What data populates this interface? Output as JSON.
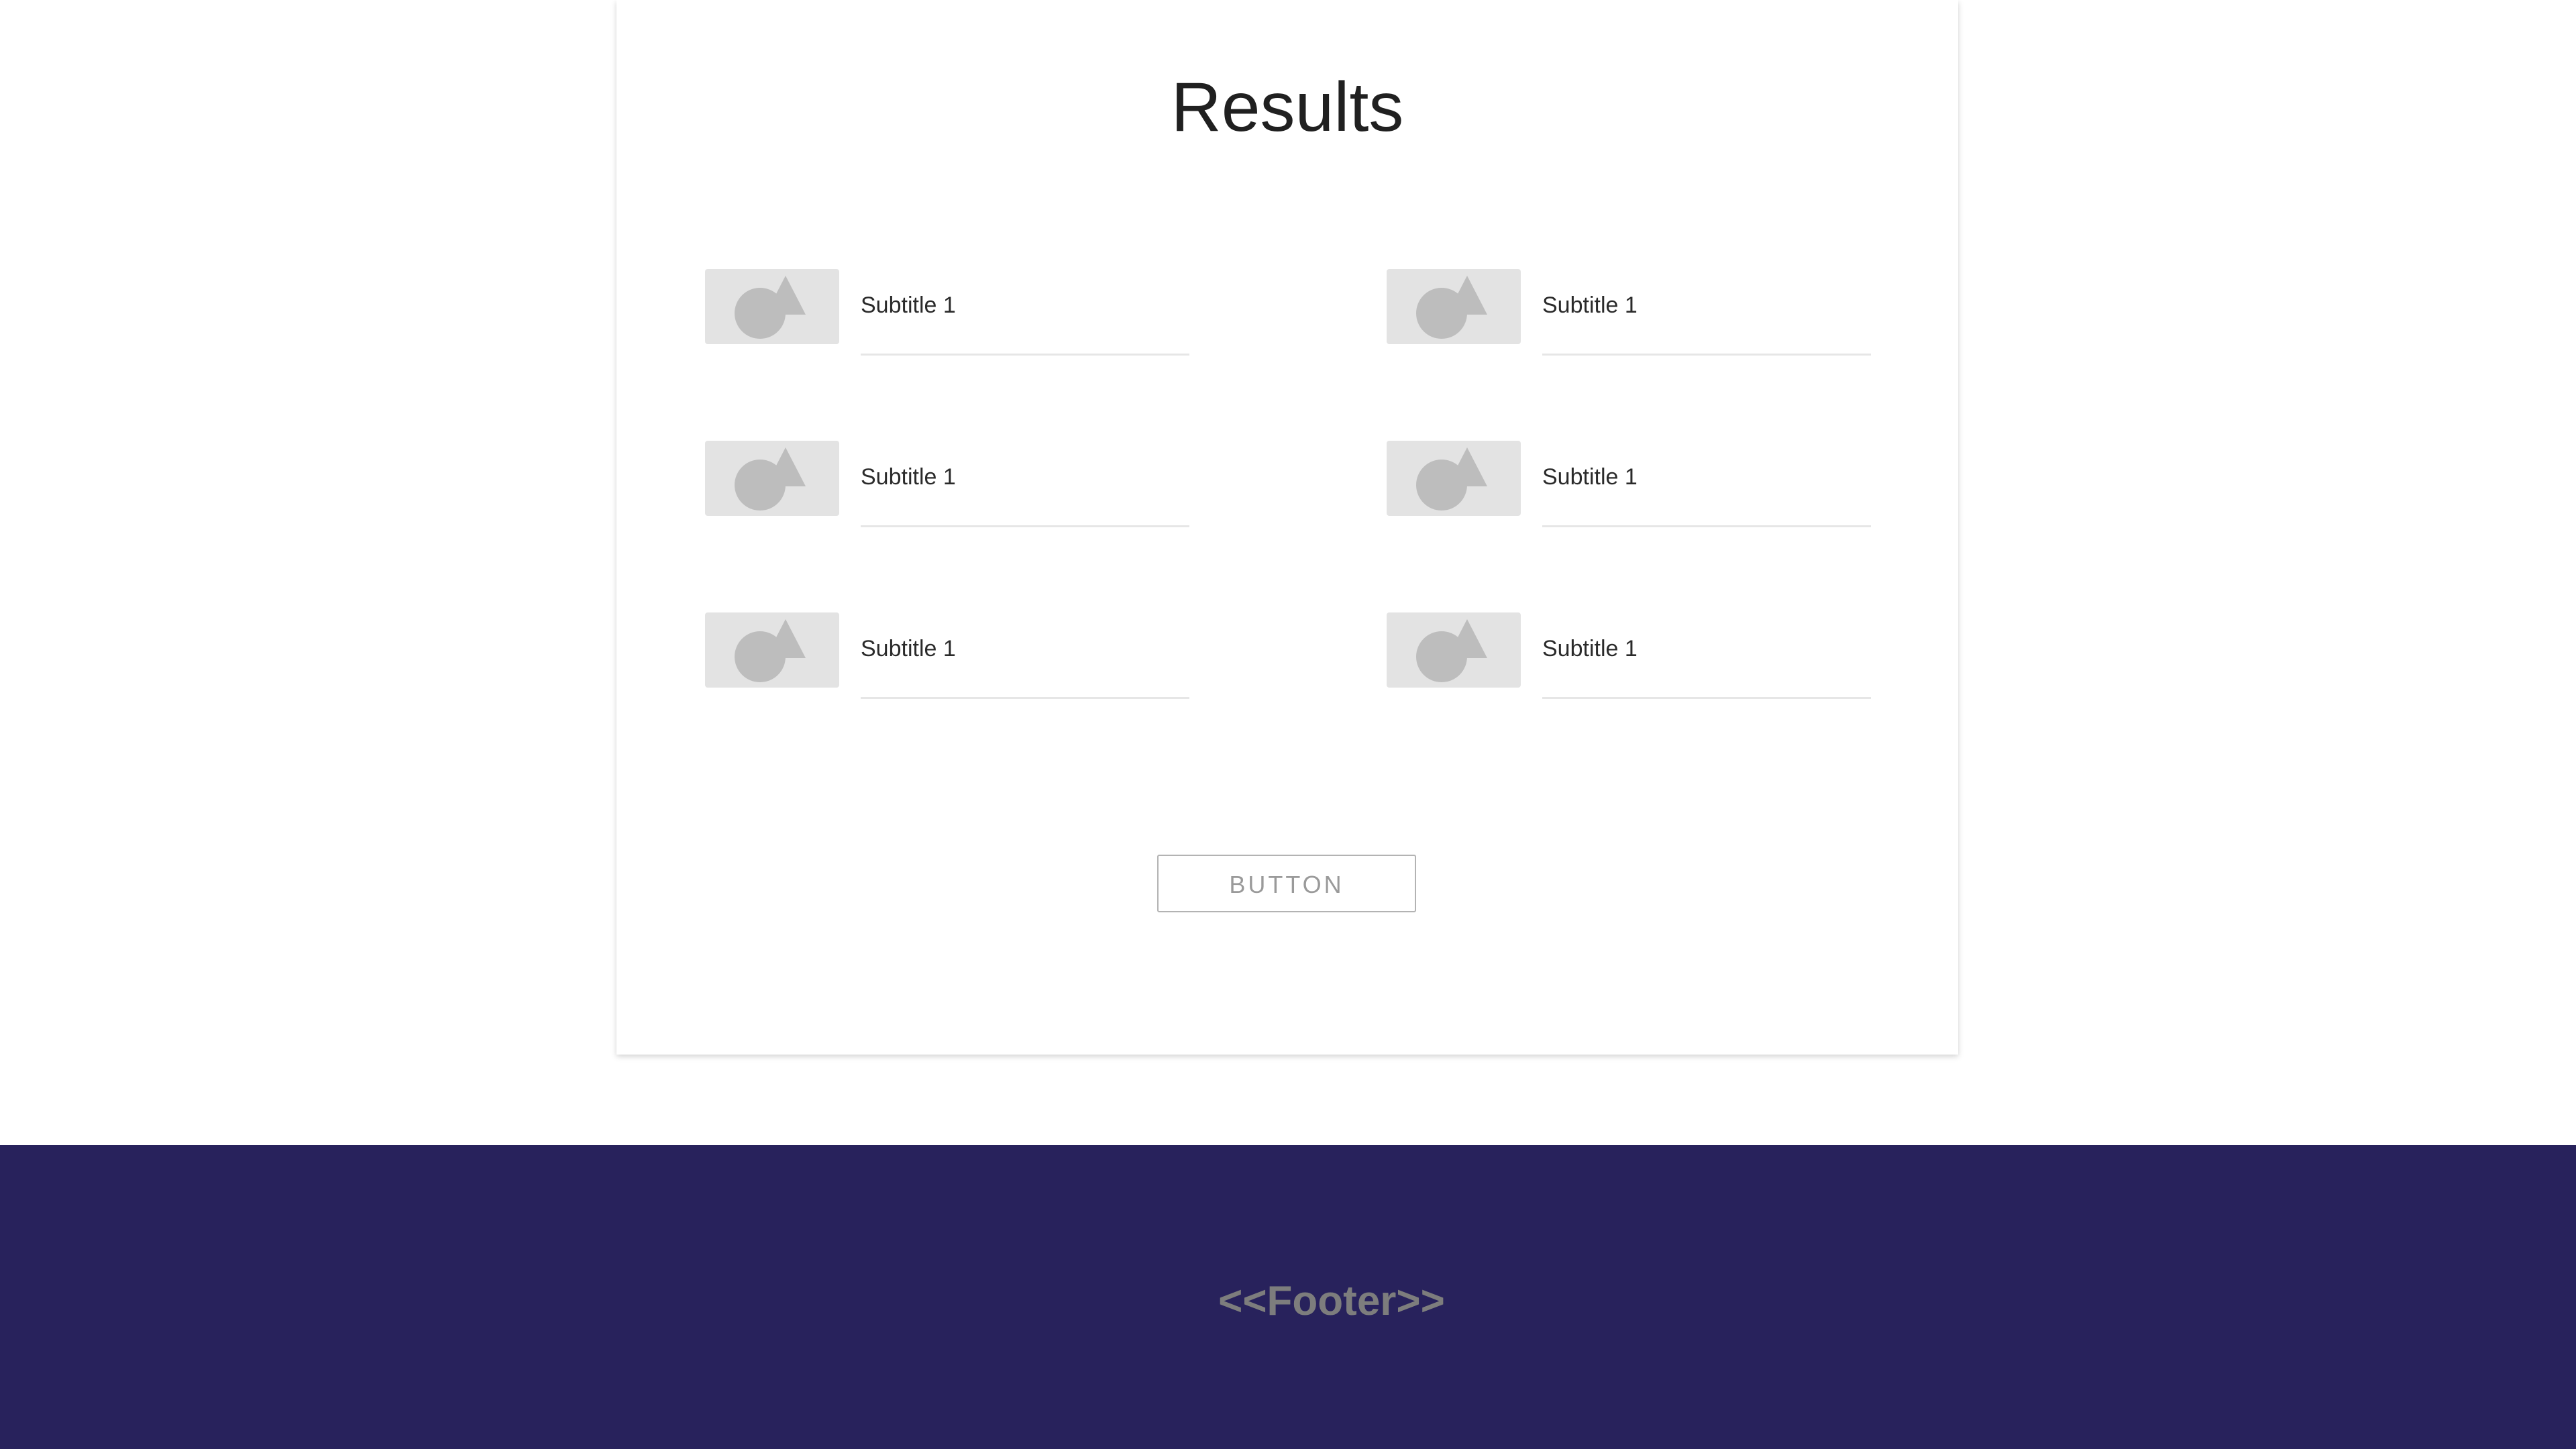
{
  "page": {
    "title": "Results"
  },
  "results": {
    "items": [
      {
        "subtitle": "Subtitle 1",
        "thumbnail_icon": "image-placeholder-icon"
      },
      {
        "subtitle": "Subtitle 1",
        "thumbnail_icon": "image-placeholder-icon"
      },
      {
        "subtitle": "Subtitle 1",
        "thumbnail_icon": "image-placeholder-icon"
      },
      {
        "subtitle": "Subtitle 1",
        "thumbnail_icon": "image-placeholder-icon"
      },
      {
        "subtitle": "Subtitle 1",
        "thumbnail_icon": "image-placeholder-icon"
      },
      {
        "subtitle": "Subtitle 1",
        "thumbnail_icon": "image-placeholder-icon"
      }
    ]
  },
  "actions": {
    "button_label": "BUTTON"
  },
  "footer": {
    "text": "<<Footer>>"
  },
  "colors": {
    "footer_background": "#28225c",
    "footer_text": "#7d7d7d",
    "placeholder_background": "#e3e3e3",
    "placeholder_shape": "#bdbdbd",
    "button_border": "#b3b3b3",
    "button_text": "#9a9a9a"
  }
}
